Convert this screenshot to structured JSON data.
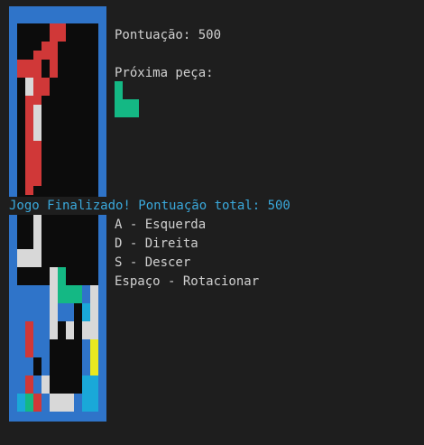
{
  "hud": {
    "score_text": "Pontuação: 500",
    "next_piece_label": "Próxima peça:",
    "game_over_text": "Jogo Finalizado! Pontuação total: 500",
    "controls": [
      "A - Esquerda",
      "D - Direita",
      "S - Descer",
      "Espaço - Rotacionar"
    ]
  },
  "colors": {
    "border": "#2f74c9",
    "background": "#0c0c0c",
    "red": "#d03838",
    "white": "#d8d8d8",
    "green": "#14b884",
    "yellow": "#e8e820",
    "cyan": "#1aa8d8",
    "blue": "#2f74c9",
    "game_over_text": "#3aa9dc"
  },
  "next_piece": {
    "color": "green",
    "cells": [
      [
        0,
        0
      ],
      [
        0,
        1
      ],
      [
        1,
        1
      ],
      [
        2,
        1
      ]
    ]
  },
  "board": {
    "cols": 10,
    "rows": 42,
    "cells": [
      {
        "c": 4,
        "r": 0,
        "h": 2,
        "color": "red"
      },
      {
        "c": 5,
        "r": 0,
        "h": 2,
        "color": "red"
      },
      {
        "c": 3,
        "r": 2,
        "h": 2,
        "color": "red"
      },
      {
        "c": 4,
        "r": 2,
        "h": 4,
        "color": "red"
      },
      {
        "c": 2,
        "r": 3,
        "h": 2,
        "color": "red"
      },
      {
        "c": 0,
        "r": 4,
        "h": 2,
        "color": "red"
      },
      {
        "c": 1,
        "r": 4,
        "h": 2,
        "color": "red"
      },
      {
        "c": 2,
        "r": 5,
        "h": 4,
        "color": "red"
      },
      {
        "c": 3,
        "r": 6,
        "h": 2,
        "color": "red"
      },
      {
        "c": 1,
        "r": 6,
        "h": 2,
        "color": "white"
      },
      {
        "c": 1,
        "r": 8,
        "h": 4,
        "color": "red"
      },
      {
        "c": 2,
        "r": 9,
        "h": 4,
        "color": "white"
      },
      {
        "c": 1,
        "r": 12,
        "h": 7,
        "color": "red"
      },
      {
        "c": 2,
        "r": 13,
        "h": 5,
        "color": "red"
      },
      {
        "c": 2,
        "r": 21,
        "h": 6,
        "color": "white"
      },
      {
        "c": 1,
        "r": 25,
        "h": 2,
        "color": "white"
      },
      {
        "c": 0,
        "r": 25,
        "h": 2,
        "color": "white"
      },
      {
        "c": 4,
        "r": 27,
        "h": 8,
        "color": "white"
      },
      {
        "c": 5,
        "r": 27,
        "h": 2,
        "color": "green"
      },
      {
        "c": 5,
        "r": 29,
        "h": 2,
        "color": "green"
      },
      {
        "c": 6,
        "r": 29,
        "h": 2,
        "color": "green"
      },
      {
        "c": 7,
        "r": 29,
        "h": 2,
        "color": "green"
      },
      {
        "c": 0,
        "r": 29,
        "h": 12,
        "color": "blue"
      },
      {
        "c": 1,
        "r": 29,
        "h": 4,
        "color": "blue"
      },
      {
        "c": 2,
        "r": 29,
        "h": 2,
        "color": "blue"
      },
      {
        "c": 2,
        "r": 31,
        "h": 6,
        "color": "blue"
      },
      {
        "c": 3,
        "r": 29,
        "h": 8,
        "color": "blue"
      },
      {
        "c": 1,
        "r": 33,
        "h": 4,
        "color": "red"
      },
      {
        "c": 1,
        "r": 37,
        "h": 2,
        "color": "blue"
      },
      {
        "c": 5,
        "r": 31,
        "h": 2,
        "color": "blue"
      },
      {
        "c": 6,
        "r": 31,
        "h": 2,
        "color": "blue"
      },
      {
        "c": 6,
        "r": 33,
        "h": 2,
        "color": "white"
      },
      {
        "c": 8,
        "r": 29,
        "h": 2,
        "color": "blue"
      },
      {
        "c": 9,
        "r": 29,
        "h": 2,
        "color": "white"
      },
      {
        "c": 8,
        "r": 31,
        "h": 2,
        "color": "cyan"
      },
      {
        "c": 9,
        "r": 31,
        "h": 4,
        "color": "white"
      },
      {
        "c": 8,
        "r": 33,
        "h": 2,
        "color": "white"
      },
      {
        "c": 9,
        "r": 35,
        "h": 4,
        "color": "yellow"
      },
      {
        "c": 8,
        "r": 35,
        "h": 6,
        "color": "blue"
      },
      {
        "c": 3,
        "r": 37,
        "h": 2,
        "color": "blue"
      },
      {
        "c": 9,
        "r": 39,
        "h": 2,
        "color": "cyan"
      },
      {
        "c": 1,
        "r": 39,
        "h": 2,
        "color": "red"
      },
      {
        "c": 2,
        "r": 39,
        "h": 2,
        "color": "blue"
      },
      {
        "c": 3,
        "r": 39,
        "h": 2,
        "color": "white"
      },
      {
        "c": 0,
        "r": 41,
        "h": 2,
        "color": "cyan"
      },
      {
        "c": 1,
        "r": 41,
        "h": 2,
        "color": "green"
      },
      {
        "c": 2,
        "r": 41,
        "h": 2,
        "color": "red"
      },
      {
        "c": 3,
        "r": 41,
        "h": 2,
        "color": "blue"
      },
      {
        "c": 4,
        "r": 41,
        "h": 2,
        "color": "white"
      },
      {
        "c": 5,
        "r": 41,
        "h": 2,
        "color": "white"
      },
      {
        "c": 6,
        "r": 41,
        "h": 2,
        "color": "white"
      },
      {
        "c": 7,
        "r": 41,
        "h": 2,
        "color": "blue"
      },
      {
        "c": 8,
        "r": 41,
        "h": 2,
        "color": "cyan"
      },
      {
        "c": 9,
        "r": 41,
        "h": 2,
        "color": "cyan"
      },
      {
        "c": 8,
        "r": 39,
        "h": 2,
        "color": "cyan"
      }
    ]
  }
}
